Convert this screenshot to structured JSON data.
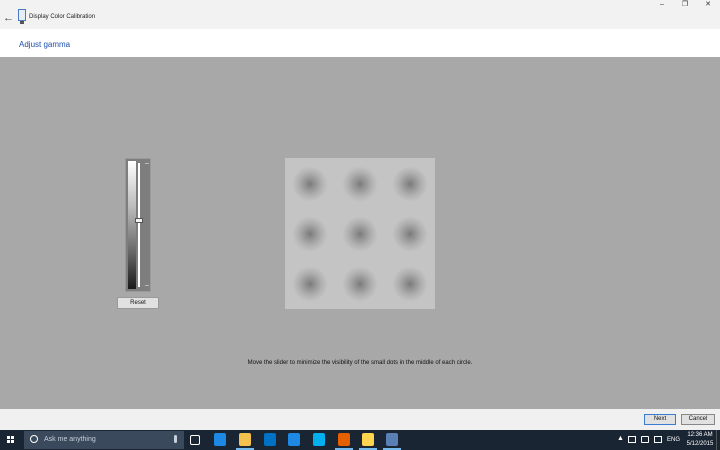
{
  "window": {
    "title": "Display Color Calibration",
    "back_glyph": "←",
    "minimize_glyph": "–",
    "restore_glyph": "❐",
    "close_glyph": "✕"
  },
  "page": {
    "title": "Adjust gamma",
    "instructions": "Move the slider to minimize the visibility of the small dots in the middle of each circle."
  },
  "gamma_slider": {
    "value_fraction": 0.46,
    "reset_label": "Reset"
  },
  "pattern": {
    "rows": 3,
    "cols": 3
  },
  "footer": {
    "next_label": "Next",
    "cancel_label": "Cancel"
  },
  "taskbar": {
    "search_placeholder": "Ask me anything",
    "apps": [
      {
        "name": "task-view-icon",
        "color": "#1a2533"
      },
      {
        "name": "store-app-icon",
        "color": "#1e88e5"
      },
      {
        "name": "file-explorer-icon",
        "color": "#f2c14e"
      },
      {
        "name": "outlook-icon",
        "color": "#0072c6"
      },
      {
        "name": "edge-icon",
        "color": "#1e88e5"
      },
      {
        "name": "skype-icon",
        "color": "#00aff0"
      },
      {
        "name": "firefox-icon",
        "color": "#e66000"
      },
      {
        "name": "messaging-icon",
        "color": "#ffd54f"
      },
      {
        "name": "color-calibration-app-icon",
        "color": "#5a7fb5"
      }
    ],
    "tray": {
      "language": "ENG",
      "time": "12:36 AM",
      "date": "5/12/2015"
    }
  }
}
